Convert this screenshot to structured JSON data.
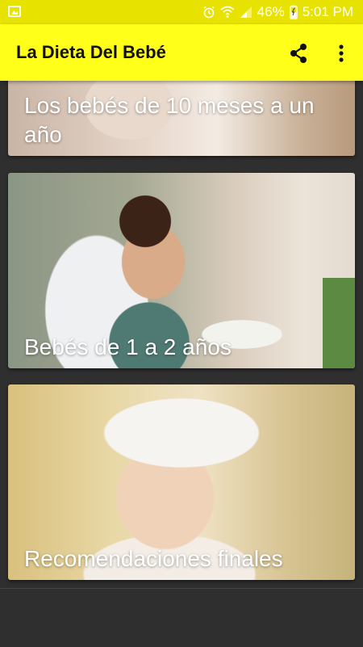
{
  "status_bar": {
    "battery": "46%",
    "time": "5:01 PM"
  },
  "app_bar": {
    "title": "La Dieta Del Bebé",
    "icons": [
      "share-icon",
      "more-vert-icon"
    ]
  },
  "cards": [
    {
      "caption": "Los bebés de 10 meses a un año"
    },
    {
      "caption": "Bebés de 1 a 2 años"
    },
    {
      "caption": "Recomendaciones finales"
    }
  ],
  "colors": {
    "app_bar": "#ffff1a",
    "status_bar": "#e8e200",
    "background": "#2f2f2f"
  }
}
